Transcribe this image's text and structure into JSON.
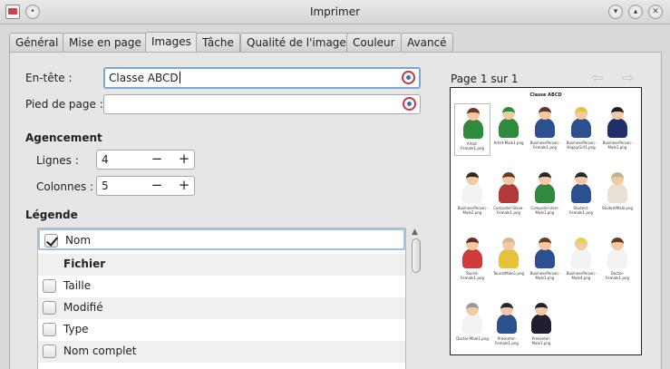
{
  "window": {
    "title": "Imprimer"
  },
  "tabs": [
    {
      "label": "Général",
      "active": false
    },
    {
      "label": "Mise en page",
      "active": false
    },
    {
      "label": "Images",
      "active": true
    },
    {
      "label": "Tâche",
      "active": false
    },
    {
      "label": "Qualité de l'image",
      "active": false
    },
    {
      "label": "Couleur",
      "active": false
    },
    {
      "label": "Avancé",
      "active": false
    }
  ],
  "form": {
    "header_label": "En-tête :",
    "header_value": "Classe ABCD",
    "footer_label": "Pied de page :",
    "footer_value": ""
  },
  "layout": {
    "section_title": "Agencement",
    "rows_label": "Lignes :",
    "rows_value": "4",
    "cols_label": "Colonnes :",
    "cols_value": "5"
  },
  "legend": {
    "section_title": "Légende",
    "items": [
      {
        "label": "Nom",
        "checked": true,
        "type": "checkbox"
      },
      {
        "label": "Fichier",
        "checked": false,
        "type": "header"
      },
      {
        "label": "Taille",
        "checked": false,
        "type": "checkbox"
      },
      {
        "label": "Modifié",
        "checked": false,
        "type": "checkbox"
      },
      {
        "label": "Type",
        "checked": false,
        "type": "checkbox"
      },
      {
        "label": "Nom complet",
        "checked": false,
        "type": "checkbox"
      }
    ]
  },
  "preview": {
    "page_label": "Page 1 sur 1",
    "title": "Classe ABCD",
    "items": [
      {
        "caption": "Artist-Female1.png",
        "hair": "#6b3a1f",
        "body": "#2f8a3d"
      },
      {
        "caption": "Artist-Male1.png",
        "hair": "#2f8a3d",
        "body": "#2f8a3d"
      },
      {
        "caption": "BusinessPerson-Female1.png",
        "hair": "#5a3a22",
        "body": "#2c4f8f"
      },
      {
        "caption": "BusinessPerson-HappyGirl1.png",
        "hair": "#e6c23a",
        "body": "#2c4f8f"
      },
      {
        "caption": "BusinessPerson-Male1.png",
        "hair": "#222222",
        "body": "#1f2f6a"
      },
      {
        "caption": "BusinessPerson-Male2.png",
        "hair": "#3a2a1a",
        "body": "#f2f2f2"
      },
      {
        "caption": "Computer-Slave-Female1.png",
        "hair": "#6b3a1f",
        "body": "#b03a3a"
      },
      {
        "caption": "Computer-User-Male1.png",
        "hair": "#2a2a2a",
        "body": "#2f8a3d"
      },
      {
        "caption": "Student-Female1.png",
        "hair": "#2a2a2a",
        "body": "#2c4f8f"
      },
      {
        "caption": "StudentMale.png",
        "hair": "#c8b48a",
        "body": "#e8e2d4"
      },
      {
        "caption": "Tourist-Female1.png",
        "hair": "#6b2a1a",
        "body": "#d03a3a"
      },
      {
        "caption": "TouristMale1.png",
        "hair": "#d8b88a",
        "body": "#e6c23a"
      },
      {
        "caption": "BusinessPerson-Male3.png",
        "hair": "#6b3a1f",
        "body": "#2c4f8f"
      },
      {
        "caption": "BusinessPerson-Male4.png",
        "hair": "#e6d24a",
        "body": "#f2f2f2"
      },
      {
        "caption": "Doctor-Female1.png",
        "hair": "#6b3a1f",
        "body": "#f2f2f2"
      },
      {
        "caption": "Doctor-Male1.png",
        "hair": "#9a9a9a",
        "body": "#f2f2f2"
      },
      {
        "caption": "Presenter-Female1.png",
        "hair": "#2a2a2a",
        "body": "#2c4f8f"
      },
      {
        "caption": "Presenter-Male1.png",
        "hair": "#222222",
        "body": "#1f1f2f"
      }
    ]
  }
}
